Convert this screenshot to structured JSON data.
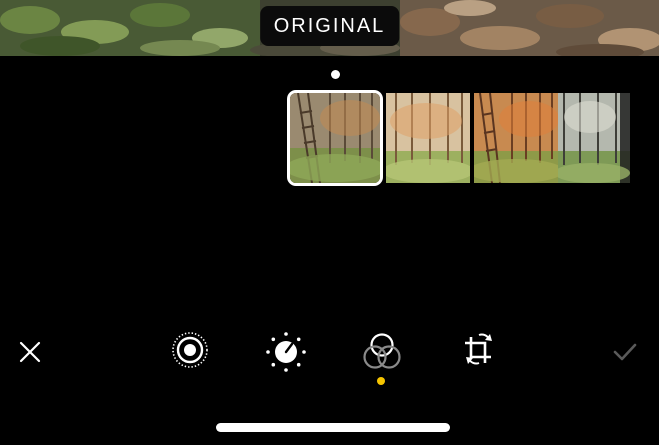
{
  "header": {
    "badge_label": "ORIGINAL"
  },
  "filters": {
    "selected_index": 0,
    "items": [
      {
        "id": "original",
        "style": "natural"
      },
      {
        "id": "vivid",
        "style": "vivid"
      },
      {
        "id": "vivid-warm",
        "style": "warm"
      },
      {
        "id": "vivid-cool",
        "style": "cool"
      },
      {
        "id": "dramatic",
        "style": "dark"
      }
    ]
  },
  "toolbar": {
    "cancel_icon": "close-icon",
    "live_icon": "live-photo-icon",
    "adjust_icon": "adjust-dial-icon",
    "filters_icon": "filters-icon",
    "crop_icon": "crop-rotate-icon",
    "done_icon": "checkmark-icon",
    "active_tab": "filters"
  },
  "colors": {
    "background": "#000000",
    "active_indicator": "#f5c400",
    "done_disabled": "#5a5a5a",
    "icon": "#ffffff"
  }
}
